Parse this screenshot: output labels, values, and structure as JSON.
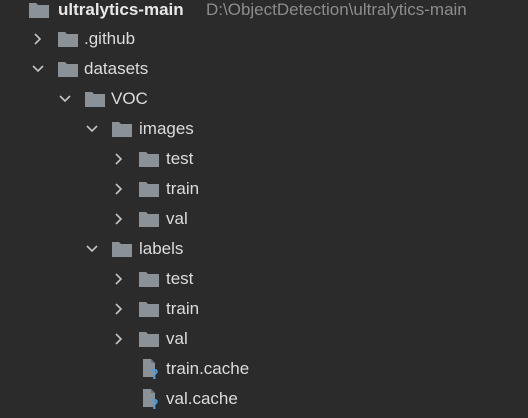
{
  "project": {
    "name": "ultralytics-main",
    "path": "D:\\ObjectDetection\\ultralytics-main"
  },
  "nodes": [
    {
      "label": ".github",
      "kind": "folder",
      "state": "collapsed",
      "depth": 1
    },
    {
      "label": "datasets",
      "kind": "folder",
      "state": "expanded",
      "depth": 1
    },
    {
      "label": "VOC",
      "kind": "folder",
      "state": "expanded",
      "depth": 2
    },
    {
      "label": "images",
      "kind": "folder",
      "state": "expanded",
      "depth": 3
    },
    {
      "label": "test",
      "kind": "folder",
      "state": "collapsed",
      "depth": 4
    },
    {
      "label": "train",
      "kind": "folder",
      "state": "collapsed",
      "depth": 4
    },
    {
      "label": "val",
      "kind": "folder",
      "state": "collapsed",
      "depth": 4
    },
    {
      "label": "labels",
      "kind": "folder",
      "state": "expanded",
      "depth": 3
    },
    {
      "label": "test",
      "kind": "folder",
      "state": "collapsed",
      "depth": 4
    },
    {
      "label": "train",
      "kind": "folder",
      "state": "collapsed",
      "depth": 4
    },
    {
      "label": "val",
      "kind": "folder",
      "state": "collapsed",
      "depth": 4
    },
    {
      "label": "train.cache",
      "kind": "unknown-file",
      "depth": 4
    },
    {
      "label": "val.cache",
      "kind": "unknown-file",
      "depth": 4
    }
  ],
  "colors": {
    "background": "#2b2b2b",
    "folder": "#8b9297",
    "text": "#dcdcdc",
    "path_text": "#8c8c8c",
    "question_mark": "#4a9ee0"
  },
  "icons": {
    "collapsed": "chevron-right-icon",
    "expanded": "chevron-down-icon",
    "folder": "folder-icon",
    "unknown_file": "unknown-file-icon"
  }
}
